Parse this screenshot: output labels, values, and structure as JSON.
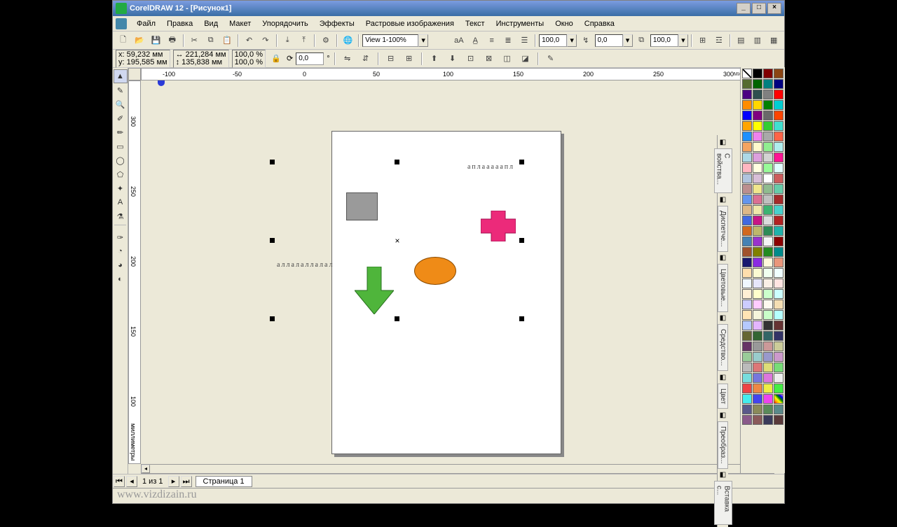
{
  "title": "CorelDRAW 12 - [Рисунок1]",
  "menus": [
    "Файл",
    "Правка",
    "Вид",
    "Макет",
    "Упорядочить",
    "Эффекты",
    "Растровые изображения",
    "Текст",
    "Инструменты",
    "Окно",
    "Справка"
  ],
  "toolbar1": {
    "view_combo": "View 1-100%",
    "spin1": "100,0",
    "spin2": "0,0",
    "spin3": "100,0"
  },
  "propbar": {
    "x_label": "x:",
    "x_val": "59,232 мм",
    "y_label": "y:",
    "y_val": "195,585 мм",
    "w_val": "221,284 мм",
    "h_val": "135,838 мм",
    "sx": "100,0",
    "sy": "100,0",
    "pct": "%",
    "rot": "0,0",
    "deg": "°"
  },
  "ruler": {
    "units": "миллиметры",
    "ticks_h": [
      "-100",
      "-50",
      "0",
      "50",
      "100",
      "150",
      "200",
      "250",
      "300"
    ],
    "ticks_v": [
      "300",
      "250",
      "200",
      "150",
      "100"
    ]
  },
  "dockers": [
    "С войства...",
    "Диспетче...",
    "Цветовые...",
    "Средство...",
    "Цвет",
    "Преобраз...",
    "Вставка с..."
  ],
  "palette_colors": [
    "none",
    "#000000",
    "#800000",
    "#8b4513",
    "#556b2f",
    "#006400",
    "#008080",
    "#000080",
    "#4b0082",
    "#2f4f4f",
    "#808080",
    "#ff0000",
    "#ff8c00",
    "#ffd700",
    "#008000",
    "#00ced1",
    "#0000ff",
    "#800080",
    "#696969",
    "#ff4500",
    "#ffa500",
    "#ffff00",
    "#32cd32",
    "#40e0d0",
    "#1e90ff",
    "#ee82ee",
    "#a9a9a9",
    "#ff6347",
    "#f4a460",
    "#fffacd",
    "#90ee90",
    "#afeeee",
    "#add8e6",
    "#dda0dd",
    "#d3d3d3",
    "#ff1493",
    "#ffb6c1",
    "#ffffe0",
    "#98fb98",
    "#e0ffff",
    "#b0c4de",
    "#d8bfd8",
    "#ffffff",
    "#cd5c5c",
    "#bc8f8f",
    "#f0e68c",
    "#8fbc8f",
    "#66cdaa",
    "#6495ed",
    "#db7093",
    "#c0c0c0",
    "#a52a2a",
    "#deb887",
    "#eee8aa",
    "#3cb371",
    "#48d1cc",
    "#4169e1",
    "#c71585",
    "#dcdcdc",
    "#b22222",
    "#d2691e",
    "#bdb76b",
    "#2e8b57",
    "#20b2aa",
    "#4682b4",
    "#9932cc",
    "#f5f5f5",
    "#8b0000",
    "#a0522d",
    "#808000",
    "#228b22",
    "#008b8b",
    "#191970",
    "#8a2be2",
    "#fff8dc",
    "#e9967a",
    "#ffdead",
    "#fafad2",
    "#f0fff0",
    "#f0ffff",
    "#f0f8ff",
    "#e6e6fa",
    "#faf0e6",
    "#ffe4e1",
    "#ffefd5",
    "#ffffcc",
    "#ccffcc",
    "#ccffff",
    "#ccccff",
    "#ffccff",
    "#fffaf0",
    "#f5deb3",
    "#ffe4b5",
    "#f5f5dc",
    "#c9ffc9",
    "#b5ffff",
    "#b5c9ff",
    "#e3b5ff",
    "#333333",
    "#663333",
    "#666633",
    "#336633",
    "#336666",
    "#333366",
    "#663366",
    "#999999",
    "#cc9999",
    "#cccc99",
    "#99cc99",
    "#99cccc",
    "#9999cc",
    "#cc99cc",
    "#bbbbbb",
    "#dd7777",
    "#dddd77",
    "#77dd77",
    "#77dddd",
    "#7777dd",
    "#dd77dd",
    "#eeeeee",
    "#ee4444",
    "#ee8844",
    "#eeee44",
    "#44ee44",
    "#44eeee",
    "#4444ee",
    "#ee44ee",
    "#rainbow",
    "#5a5a8a",
    "#8a8a5a",
    "#5a8a5a",
    "#5a8a8a",
    "#8a5a8a",
    "#8a5a5a",
    "#3a3a5a",
    "#5a3a3a"
  ],
  "status": {
    "watermark": "www.vizdizain.ru",
    "page_of": "1 из 1",
    "page_tab": "Страница 1"
  },
  "toolbox_tools": [
    "pick",
    "shape",
    "zoom",
    "freehand",
    "smart",
    "rect",
    "ellipse",
    "polygon",
    "shapes",
    "text",
    "interactive",
    "eyedrop",
    "outline",
    "fill",
    "fill2"
  ],
  "canvas": {
    "envelope1": "аплааааапл",
    "envelope2": "аллалаллалал"
  }
}
